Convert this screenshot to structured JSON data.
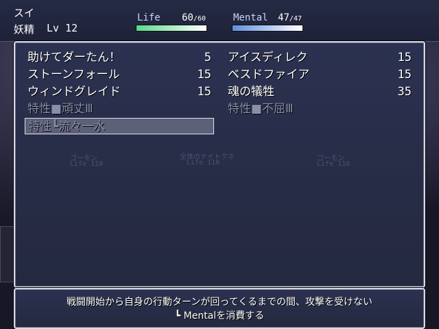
{
  "actor": {
    "name": "スイ",
    "class": "妖精",
    "level": "Lv 12",
    "life": {
      "label": "Life",
      "current": "60",
      "max": "60",
      "fraction": 1.0,
      "color": "#5ad88a"
    },
    "mental": {
      "label": "Mental",
      "current": "47",
      "max": "47",
      "fraction": 1.0,
      "color": "#5f8fe0"
    }
  },
  "skills": [
    {
      "name": "助けてダーたん！",
      "cost": "5",
      "enabled": true,
      "selected": false
    },
    {
      "name": "アイスディレク",
      "cost": "15",
      "enabled": true,
      "selected": false
    },
    {
      "name": "ストーンフォール",
      "cost": "15",
      "enabled": true,
      "selected": false
    },
    {
      "name": "ベスドファイア",
      "cost": "15",
      "enabled": true,
      "selected": false
    },
    {
      "name": "ウィンドグレイド",
      "cost": "15",
      "enabled": true,
      "selected": false
    },
    {
      "name": "魂の犠牲",
      "cost": "35",
      "enabled": true,
      "selected": false
    },
    {
      "name": "特性■頑丈Ⅲ",
      "cost": "",
      "enabled": false,
      "selected": false
    },
    {
      "name": "特性■不屈Ⅲ",
      "cost": "",
      "enabled": false,
      "selected": false
    },
    {
      "name": "特性┗流々一水",
      "cost": "",
      "enabled": false,
      "selected": true
    }
  ],
  "help": {
    "line1": "戦闘開始から自身の行動ターンが回ってくるまでの間、攻撃を受けない",
    "line2": "┗ Mentalを消費する"
  },
  "background": {
    "enemy_left": "ゴーモン",
    "enemy_left_life": "Life 110",
    "enemy_center": "全体のナイトクネ",
    "enemy_center_life": "Life 110",
    "enemy_right": "ゴーモン",
    "enemy_right_life": "Life 110"
  }
}
